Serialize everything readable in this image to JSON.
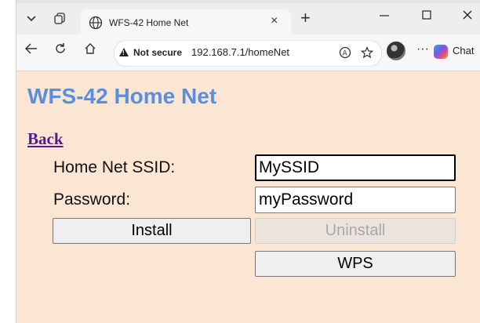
{
  "browser": {
    "tab_title": "WFS-42 Home Net",
    "tab_close": "×",
    "new_tab": "+",
    "security_label": "Not secure",
    "url": "192.168.7.1/homeNet",
    "chat_label": "Chat",
    "more_label": "···"
  },
  "page": {
    "heading": "WFS-42 Home Net",
    "back_link": "Back",
    "ssid_label": "Home Net SSID:",
    "ssid_value": "MySSID",
    "password_label": "Password:",
    "password_value": "myPassword",
    "install_label": "Install",
    "uninstall_label": "Uninstall",
    "wps_label": "WPS"
  },
  "colors": {
    "page_background": "#fbe6d4",
    "heading": "#5a8fe0",
    "link_visited": "#551a8b"
  }
}
